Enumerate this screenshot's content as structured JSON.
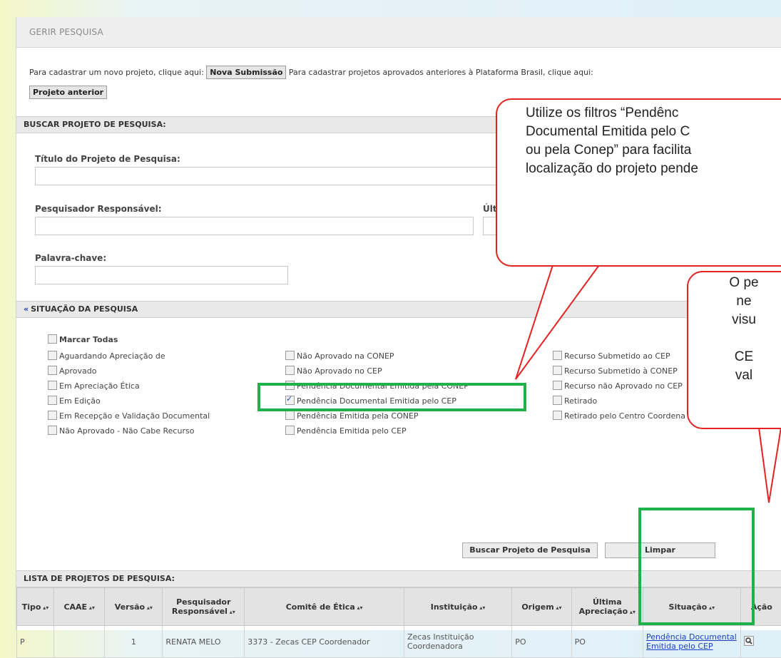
{
  "header": {
    "title": "GERIR PESQUISA"
  },
  "intro": {
    "text_before": "Para cadastrar um novo projeto, clique aqui:",
    "new_submission_label": "Nova Submissão",
    "text_middle": "Para cadastrar projetos aprovados anteriores à Plataforma Brasil, clique aqui:",
    "previous_project_label": "Projeto anterior"
  },
  "search": {
    "section_title": "BUSCAR PROJETO DE PESQUISA:",
    "title_label": "Título do Projeto de Pesquisa:",
    "researcher_label": "Pesquisador Responsável:",
    "last_label": "Últ",
    "keyword_label": "Palavra-chave:",
    "status_section_title": "SITUAÇÃO DA PESQUISA",
    "collapse_icon": "«",
    "mark_all": "Marcar Todas",
    "col1": [
      "Aguardando Apreciação de",
      "Aprovado",
      "Em Apreciação Ética",
      "Em Edição",
      "Em Recepção e Validação Documental",
      "Não Aprovado - Não Cabe Recurso"
    ],
    "col2": [
      "Não Aprovado na CONEP",
      "Não Aprovado no CEP",
      "Pendência Documental Emitida pela CONEP",
      "Pendência Documental Emitida pelo CEP",
      "Pendência Emitida pela CONEP",
      "Pendência Emitida pelo CEP"
    ],
    "col3": [
      "Recurso Submetido ao CEP",
      "Recurso Submetido à CONEP",
      "Recurso não Aprovado no CEP",
      "Retirado",
      "Retirado pelo Centro Coordena"
    ],
    "checked_item": "Pendência Documental Emitida pelo CEP",
    "search_button": "Buscar Projeto de Pesquisa",
    "clear_button": "Limpar"
  },
  "list": {
    "section_title": "LISTA DE PROJETOS DE PESQUISA:",
    "columns": [
      "Tipo",
      "CAAE",
      "Versão",
      "Pesquisador Responsável",
      "Comitê de Ética",
      "Instituição",
      "Origem",
      "Última Apreciação",
      "Situação",
      "Ação"
    ],
    "rows": [
      {
        "tipo": "P",
        "caae": "",
        "versao": "1",
        "pesquisador": "RENATA MELO",
        "comite": "3373 - Zecas CEP Coordenador",
        "instituicao": "Zecas Instituição Coordenadora",
        "origem": "PO",
        "ultima": "PO",
        "situacao": "Pendência Documental Emitida pelo CEP",
        "acao_icon": "search-icon"
      }
    ]
  },
  "callouts": {
    "first": [
      "Utilize os filtros “Pendênc",
      "Documental Emitida pelo C",
      "ou pela Conep” para facilita",
      "localização do projeto pende"
    ],
    "second": [
      "O pe",
      "ne",
      "visu",
      "",
      "CE",
      "val"
    ]
  },
  "colors": {
    "callout_border": "#e52222",
    "highlight": "#1fb24a",
    "link": "#1a3fc5"
  }
}
